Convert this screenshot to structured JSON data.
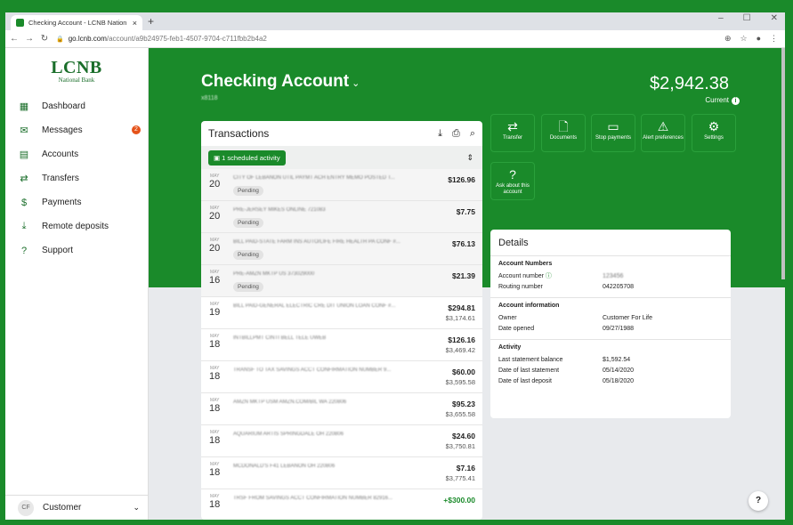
{
  "browser": {
    "tab_title": "Checking Account - LCNB Nation",
    "url_host": "go.lcnb.com",
    "url_path": "/account/a9b24975-feb1-4507-9704-c711fbb2b4a2"
  },
  "sidebar": {
    "logo_main": "LCNB",
    "logo_sub": "National Bank",
    "items": [
      {
        "label": "Dashboard",
        "icon": "dashboard-icon",
        "glyph": "▦"
      },
      {
        "label": "Messages",
        "icon": "mail-icon",
        "glyph": "✉",
        "badge": "2"
      },
      {
        "label": "Accounts",
        "icon": "accounts-icon",
        "glyph": "▤"
      },
      {
        "label": "Transfers",
        "icon": "transfer-icon",
        "glyph": "⇄"
      },
      {
        "label": "Payments",
        "icon": "payments-icon",
        "glyph": "$"
      },
      {
        "label": "Remote deposits",
        "icon": "deposit-icon",
        "glyph": "⤓"
      },
      {
        "label": "Support",
        "icon": "help-icon",
        "glyph": "?"
      }
    ],
    "user_initials": "CF",
    "user_name": "Customer"
  },
  "header": {
    "title": "Checking Account",
    "masked_number": "x8118",
    "balance": "$2,942.38",
    "balance_label": "Current"
  },
  "transactions": {
    "title": "Transactions",
    "scheduled": "1 scheduled activity",
    "rows": [
      {
        "mon": "MAY",
        "day": "20",
        "desc": "CITY OF LEBANON UTIL PAYMT ACH ENTRY MEMO POSTED T...",
        "status": "Pending",
        "amount": "$126.96",
        "balance": ""
      },
      {
        "mon": "MAY",
        "day": "20",
        "desc": "PRE-JERSEY MIKES ONLINE 721083",
        "status": "Pending",
        "amount": "$7.75",
        "balance": ""
      },
      {
        "mon": "MAY",
        "day": "20",
        "desc": "BILL PAID-STATE FARM INS AUTO/LIFE FIRE HEALTH PA CONF #...",
        "status": "Pending",
        "amount": "$76.13",
        "balance": ""
      },
      {
        "mon": "MAY",
        "day": "16",
        "desc": "PRE-AMZN MKTP US 373029000",
        "status": "Pending",
        "amount": "$21.39",
        "balance": ""
      },
      {
        "mon": "MAY",
        "day": "19",
        "desc": "BILL PAID-GENERAL ELECTRIC CRE DIT UNION LOAN CONF #...",
        "status": "",
        "amount": "$294.81",
        "balance": "$3,174.61"
      },
      {
        "mon": "MAY",
        "day": "18",
        "desc": "INTBILLPMT CINTI BELL TELE UWEB",
        "status": "",
        "amount": "$126.16",
        "balance": "$3,469.42"
      },
      {
        "mon": "MAY",
        "day": "18",
        "desc": "TRANSF TO TAX SAVINGS ACCT CONFIRMATION NUMBER 9...",
        "status": "",
        "amount": "$60.00",
        "balance": "$3,595.58"
      },
      {
        "mon": "MAY",
        "day": "18",
        "desc": "AMZN MKTP USM AMZN.COM/BIL WA 220806",
        "status": "",
        "amount": "$95.23",
        "balance": "$3,655.58"
      },
      {
        "mon": "MAY",
        "day": "18",
        "desc": "AQUARIUM ARTIS SPRINGDALE OH 220806",
        "status": "",
        "amount": "$24.60",
        "balance": "$3,750.81"
      },
      {
        "mon": "MAY",
        "day": "18",
        "desc": "MCDONALD'S F41 LEBANON OH 220806",
        "status": "",
        "amount": "$7.16",
        "balance": "$3,775.41"
      },
      {
        "mon": "MAY",
        "day": "18",
        "desc": "TRSF FROM SAVINGS ACCT CONFIRMATION NUMBER 82916...",
        "status": "",
        "amount": "+$300.00",
        "balance": ""
      }
    ]
  },
  "actions": [
    {
      "label": "Transfer",
      "icon": "transfer-icon",
      "glyph": "⇄"
    },
    {
      "label": "Documents",
      "icon": "document-icon",
      "glyph": "🗋"
    },
    {
      "label": "Stop payments",
      "icon": "stop-payment-icon",
      "glyph": "▭"
    },
    {
      "label": "Alert preferences",
      "icon": "alert-icon",
      "glyph": "⚠"
    },
    {
      "label": "Settings",
      "icon": "gear-icon",
      "glyph": "⚙"
    },
    {
      "label": "Ask about this account",
      "icon": "question-icon",
      "glyph": "?"
    }
  ],
  "details": {
    "title": "Details",
    "sections": [
      {
        "heading": "Account Numbers",
        "rows": [
          {
            "k": "Account number",
            "v": "123456",
            "blur": true,
            "info": true
          },
          {
            "k": "Routing number",
            "v": "042205708"
          }
        ]
      },
      {
        "heading": "Account information",
        "rows": [
          {
            "k": "Owner",
            "v": "Customer For Life"
          },
          {
            "k": "Date opened",
            "v": "09/27/1988"
          }
        ]
      },
      {
        "heading": "Activity",
        "rows": [
          {
            "k": "Last statement balance",
            "v": "$1,592.54"
          },
          {
            "k": "Date of last statement",
            "v": "05/14/2020"
          },
          {
            "k": "Date of last deposit",
            "v": "05/18/2020"
          }
        ]
      }
    ]
  },
  "colors": {
    "brand": "#1a8a2a",
    "badge": "#e5531a"
  }
}
